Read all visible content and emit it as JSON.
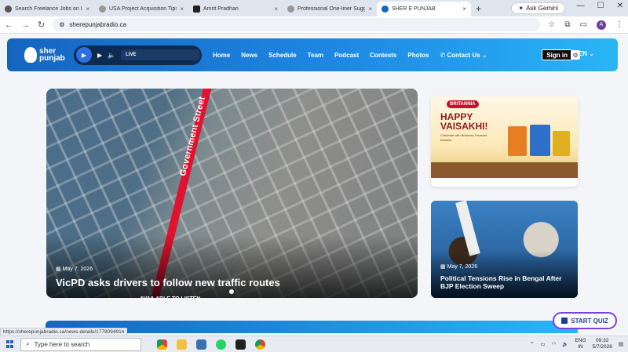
{
  "browser": {
    "tabs": [
      {
        "title": "Search Freelance Jobs on Upw",
        "active": false
      },
      {
        "title": "USA Project Acquisition Tips",
        "active": false
      },
      {
        "title": "Amrit Pradhan",
        "active": false
      },
      {
        "title": "Professional One-liner Sugges",
        "active": false
      },
      {
        "title": "SHER E PUNJAB",
        "active": true
      }
    ],
    "new_tab": "+",
    "gemini_label": "Ask Gemini",
    "url": "sherepunjabradio.ca",
    "profile_initial": "A"
  },
  "site": {
    "logo_text_1": "sher",
    "logo_text_2": "punjab",
    "player": {
      "live_label": "LIVE"
    },
    "nav": [
      "Home",
      "News",
      "Schedule",
      "Team",
      "Podcast",
      "Contests",
      "Photos"
    ],
    "contact": "Contact Us",
    "signin": "Sign in",
    "lang": "EN",
    "hero": {
      "date": "May 7, 2026",
      "title": "VicPD asks drivers to follow new traffic routes",
      "street_label": "Government Street"
    },
    "ad": {
      "brand": "BRITANNIA",
      "headline_1": "HAPPY",
      "headline_2": "VAISAKHI!",
      "subline": "Celebrate with Britannia Treasure Baskets"
    },
    "side_story": {
      "date": "May 7, 2026",
      "title": "Political Tensions Rise in Bengal After BJP Election Sweep"
    },
    "bottom_band_label": "AVAILABLE TO LISTEN",
    "quiz_button": "START QUIZ"
  },
  "status_url": "https://sherepunjabradio.ca/news-details/1778094914",
  "taskbar": {
    "search_placeholder": "Type here to search",
    "lang_1": "ENG",
    "lang_2": "IN",
    "time": "09:32",
    "date": "5/7/2026"
  }
}
